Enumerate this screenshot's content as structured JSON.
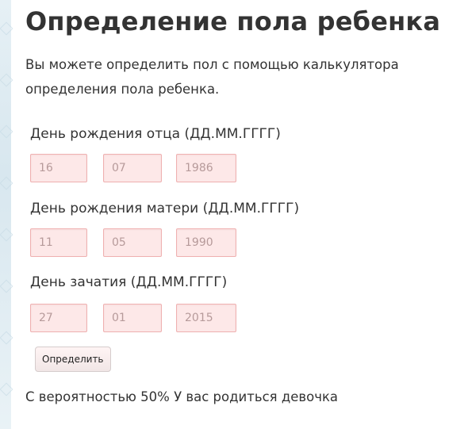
{
  "page": {
    "title": "Определение пола ребенка",
    "description": "Вы можете определить пол с помощью калькулятора определения пола ребенка."
  },
  "form": {
    "father": {
      "label": "День рождения отца (ДД.ММ.ГГГГ)",
      "day": "16",
      "month": "07",
      "year": "1986"
    },
    "mother": {
      "label": "День рождения матери (ДД.ММ.ГГГГ)",
      "day": "11",
      "month": "05",
      "year": "1990"
    },
    "conception": {
      "label": "День зачатия (ДД.ММ.ГГГГ)",
      "day": "27",
      "month": "01",
      "year": "2015"
    },
    "submit_label": "Определить"
  },
  "result": {
    "text": "С вероятностью 50% У вас родиться девочка"
  },
  "colors": {
    "field_background": "#fde8e8",
    "field_border": "#efb0b0",
    "text": "#333333"
  }
}
